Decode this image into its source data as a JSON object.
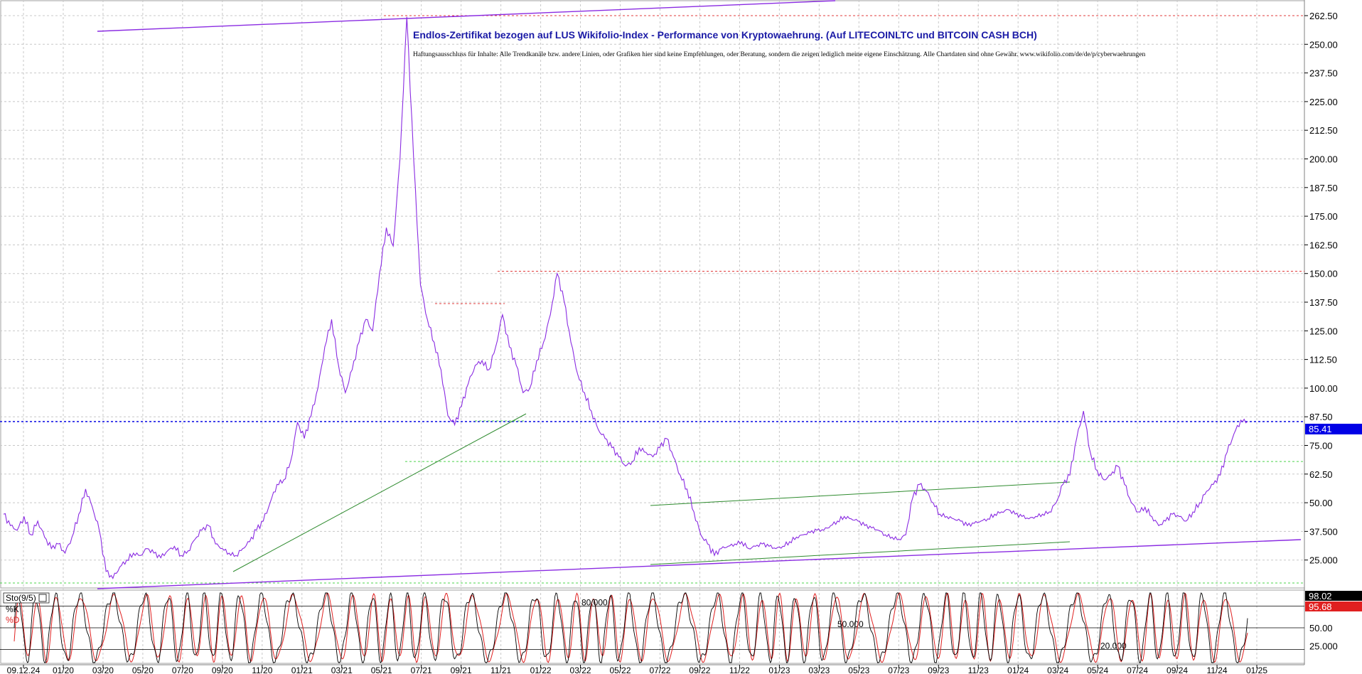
{
  "chart_data": {
    "type": "line",
    "title": "Endlos-Zertifikat bezogen auf LUS Wikifolio-Index - Performance von Kryptowaehrung. (Auf LITECOINLTC und BITCOIN CASH BCH)",
    "disclaimer": "Haftungsausschluss für Inhalte: Alle Trendkanäle bzw. andere Linien, oder Grafiken hier sind keine Empfehlungen, oder Beratung, sondern die zeigen lediglich meine eigene Einschätzung. Alle Chartdaten sind ohne Gewähr.  www.wikifolio.com/de/de/p/cyberwaehrungen",
    "ylim": [
      12.5,
      262.5
    ],
    "y_ticks": [
      "262.50",
      "250.00",
      "237.50",
      "225.00",
      "212.50",
      "200.00",
      "187.50",
      "175.00",
      "162.50",
      "150.00",
      "137.50",
      "125.00",
      "112.50",
      "100.00",
      "87.50",
      "75.00",
      "62.50",
      "50.00",
      "37.500",
      "25.000"
    ],
    "y_tick_values": [
      262.5,
      250,
      237.5,
      225,
      212.5,
      200,
      187.5,
      175,
      162.5,
      150,
      137.5,
      125,
      112.5,
      100,
      87.5,
      75,
      62.5,
      50,
      37.5,
      25
    ],
    "x_ticks": [
      "09.12.24",
      "01/20",
      "03/20",
      "05/20",
      "07/20",
      "09/20",
      "11/20",
      "01/21",
      "03/21",
      "05/21",
      "07/21",
      "09/21",
      "11/21",
      "01/22",
      "03/22",
      "05/22",
      "07/22",
      "09/22",
      "11/22",
      "01/23",
      "03/23",
      "05/23",
      "07/23",
      "09/23",
      "11/23",
      "01/24",
      "03/24",
      "05/24",
      "07/24",
      "09/24",
      "11/24",
      "01/25"
    ],
    "series": [
      {
        "name": "",
        "color": "#8a2be2",
        "values": [
          45,
          40,
          38,
          44,
          36,
          42,
          35,
          30,
          32,
          28,
          35,
          45,
          56,
          48,
          38,
          20,
          17,
          22,
          25,
          28,
          27,
          30,
          28,
          26,
          29,
          31,
          27,
          29,
          34,
          38,
          40,
          32,
          30,
          28,
          27,
          30,
          33,
          38,
          42,
          50,
          58,
          60,
          68,
          85,
          78,
          88,
          100,
          118,
          130,
          110,
          98,
          108,
          120,
          130,
          125,
          150,
          170,
          162,
          200,
          262,
          200,
          145,
          130,
          120,
          108,
          88,
          84,
          92,
          102,
          110,
          112,
          108,
          118,
          132,
          118,
          110,
          98,
          100,
          112,
          120,
          132,
          150,
          138,
          120,
          106,
          98,
          90,
          82,
          78,
          74,
          70,
          66,
          68,
          74,
          72,
          70,
          74,
          78,
          70,
          62,
          56,
          46,
          36,
          32,
          27,
          30,
          31,
          32,
          33,
          30,
          31,
          32,
          31,
          30,
          31,
          33,
          35,
          36,
          37,
          38,
          38,
          40,
          42,
          44,
          43,
          42,
          40,
          39,
          38,
          36,
          35,
          34,
          36,
          52,
          58,
          55,
          50,
          45,
          44,
          43,
          42,
          40,
          41,
          42,
          43,
          45,
          46,
          47,
          45,
          44,
          43,
          44,
          45,
          46,
          50,
          58,
          62,
          78,
          90,
          72,
          64,
          60,
          62,
          66,
          58,
          50,
          46,
          48,
          44,
          40,
          42,
          45,
          44,
          42,
          46,
          50,
          55,
          58,
          62,
          72,
          80,
          86,
          85.41
        ]
      },
      {
        "name": "",
        "color": "#2e8b2e",
        "values": []
      }
    ],
    "last_price": "85.41",
    "levels": [
      {
        "value": 262.5,
        "color": "#e23b3b",
        "style": "dotted"
      },
      {
        "value": 151,
        "color": "#e23b3b",
        "style": "dotted"
      },
      {
        "value": 85.41,
        "color": "#1a1ae6",
        "style": "dotted"
      },
      {
        "value": 68,
        "color": "#4cd44c",
        "style": "dotted"
      },
      {
        "value": 15,
        "color": "#4cd44c",
        "style": "dotted"
      }
    ],
    "oscillator": {
      "name": "Sto(9/5)",
      "k_label": "%K",
      "d_label": "%D",
      "k_color": "#000000",
      "d_color": "#e02020",
      "k_value": "98.02",
      "d_value": "95.68",
      "ylim": [
        0,
        100
      ],
      "y_ticks": [
        "50.00",
        "25.000"
      ],
      "y_tick_values": [
        50,
        25
      ],
      "levels": [
        {
          "value": 80,
          "label": "80.000"
        },
        {
          "value": 50,
          "label": "50.000"
        },
        {
          "value": 20,
          "label": "20.000"
        }
      ]
    }
  }
}
